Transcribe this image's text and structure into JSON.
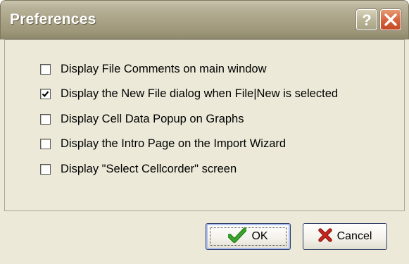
{
  "window": {
    "title": "Preferences"
  },
  "titlebar_buttons": {
    "help_icon": "question-mark-icon",
    "close_icon": "close-x-icon"
  },
  "options": [
    {
      "label": "Display File Comments on main window",
      "checked": false
    },
    {
      "label": "Display the New File dialog when File|New is selected",
      "checked": true
    },
    {
      "label": "Display Cell Data Popup on Graphs",
      "checked": false
    },
    {
      "label": "Display the Intro Page on the Import Wizard",
      "checked": false
    },
    {
      "label": "Display \"Select Cellcorder\" screen",
      "checked": false
    }
  ],
  "buttons": {
    "ok_label": "OK",
    "ok_icon": "green-checkmark-icon",
    "cancel_label": "Cancel",
    "cancel_icon": "red-x-icon"
  },
  "colors": {
    "dialog_background": "#ece9d8",
    "titlebar": "#aaa387",
    "close_button": "#d5623b",
    "ok_check": "#3aa52a",
    "cancel_x": "#c8241b"
  }
}
